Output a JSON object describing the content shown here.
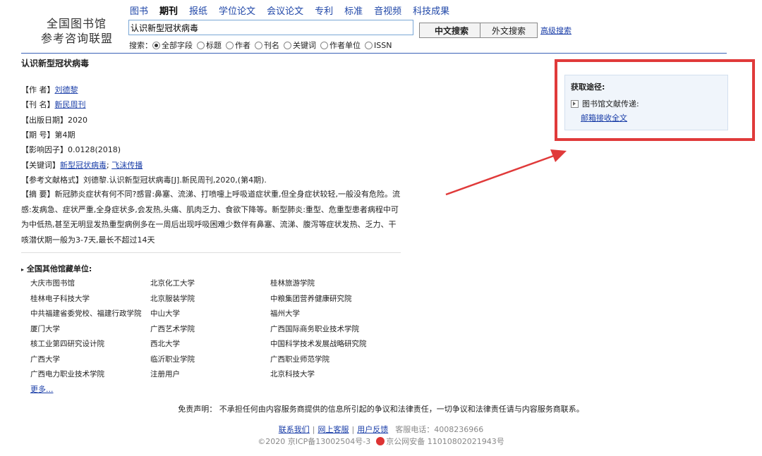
{
  "header": {
    "logo_line1": "全国图书馆",
    "logo_line2": "参考咨询联盟",
    "nav": [
      "图书",
      "期刊",
      "报纸",
      "学位论文",
      "会议论文",
      "专利",
      "标准",
      "音视频",
      "科技成果"
    ],
    "nav_active_index": 1,
    "search_value": "认识新型冠状病毒",
    "btn_chinese": "中文搜索",
    "btn_foreign": "外文搜索",
    "advanced": "高级搜索",
    "search_label": "搜索：",
    "radios": [
      "全部字段",
      "标题",
      "作者",
      "刊名",
      "关键词",
      "作者单位",
      "ISSN"
    ],
    "radio_selected_index": 0
  },
  "article": {
    "title": "认识新型冠状病毒",
    "author_label": "【作  者】",
    "author": "刘德黎",
    "journal_label": "【刊  名】",
    "journal": "新民周刊",
    "date_label": "【出版日期】",
    "date": "2020",
    "issue_label": "【期  号】",
    "issue": "第4期",
    "impact_label": "【影响因子】",
    "impact": "0.0128(2018)",
    "keywords_label": "【关键词】",
    "keyword1": "新型冠状病毒",
    "keyword_sep": "; ",
    "keyword2": "飞沫传播",
    "ref_label": "【参考文献格式】",
    "ref": "刘德黎.认识新型冠状病毒[J].新民周刊,2020,(第4期).",
    "abstract_label": "【摘  要】",
    "abstract": "新冠肺炎症状有何不同?感冒:鼻塞、流涕、打喷嚏上呼吸道症状重,但全身症状较轻,一般没有危险。流感:发病急、症状严重,全身症状多,会发热,头痛、肌肉乏力、食欲下降等。新型肺炎:重型、危重型患者病程中可为中低热,甚至无明显发热重型病例多在一周后出现呼吸困难少数伴有鼻塞、流涕、腹泻等症状发热、乏力、干咳潜伏期一般为3-7天,最长不超过14天"
  },
  "libraries": {
    "title": "全国其他馆藏单位:",
    "items": [
      "大庆市图书馆",
      "北京化工大学",
      "桂林旅游学院",
      "桂林电子科技大学",
      "北京服装学院",
      "中粮集团营养健康研究院",
      "中共福建省委党校、福建行政学院",
      "中山大学",
      "福州大学",
      "厦门大学",
      "广西艺术学院",
      "广西国际商务职业技术学院",
      "核工业第四研究设计院",
      "西北大学",
      "中国科学技术发展战略研究院",
      "广西大学",
      "临沂职业学院",
      "广西职业师范学院",
      "广西电力职业技术学院",
      "注册用户",
      "北京科技大学"
    ],
    "more": "更多..."
  },
  "access": {
    "title": "获取途径:",
    "item": "图书馆文献传递:",
    "link": "邮箱接收全文"
  },
  "footer": {
    "disclaimer": "免责声明：  不承担任何由内容服务商提供的信息所引起的争议和法律责任，一切争议和法律责任请与内容服务商联系。",
    "contact": "联系我们",
    "service": "网上客服",
    "feedback": "用户反馈",
    "phone": "客服电话：4008236966",
    "copyright": "©2020   京ICP备13002504号-3",
    "police": "京公网安备 11010802021943号"
  },
  "colors": {
    "annotation_red": "#e03a3a",
    "link_blue": "#1a3ea8"
  }
}
